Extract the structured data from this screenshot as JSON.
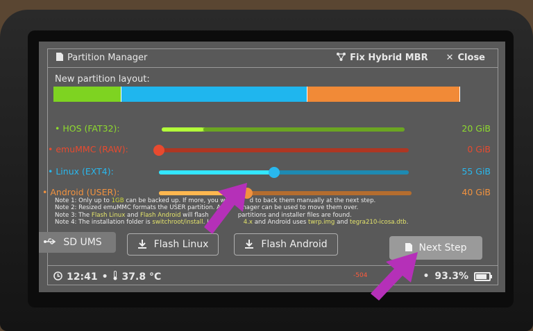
{
  "header": {
    "title": "Partition Manager",
    "title_icon": "sd-card-icon",
    "fix_hybrid_mbr": "Fix Hybrid MBR",
    "fix_icon": "network-icon",
    "close": "Close",
    "close_icon": "close-icon"
  },
  "layout": {
    "subtitle": "New partition layout:",
    "segments": [
      {
        "name": "HOS",
        "share": 0.1667,
        "color": "#7ed321"
      },
      {
        "name": "Linux",
        "share": 0.4583,
        "color": "#1fb6ee"
      },
      {
        "name": "Android",
        "share": 0.375,
        "color": "#f18a37"
      }
    ]
  },
  "partitions": [
    {
      "label": "• HOS (FAT32):",
      "size": "20 GiB",
      "color": "#8fdc2e",
      "fill_fraction": 0.17
    },
    {
      "label": "• emuMMC (RAW):",
      "size": "0 GiB",
      "color": "#e84a2f",
      "fill_fraction": 0.0
    },
    {
      "label": "• Linux (EXT4):",
      "size": "55 GiB",
      "color": "#29b8ee",
      "fill_fraction": 0.46
    },
    {
      "label": "• Android (USER):",
      "size": "40 GiB",
      "color": "#f1923f",
      "fill_fraction": 0.35
    }
  ],
  "notes": {
    "line1_a": "Note 1: Only up to ",
    "line1_hl": "1GB",
    "line1_b": " can be backed up. If more, you will",
    "line1_c": "d to back them manually at the next step.",
    "line2_a": "Note 2: Resized emuMMC formats the USER partition. A",
    "line2_b": "anager can be used to move them over.",
    "line3_a": "Note 3: The ",
    "line3_hl1": "Flash Linux",
    "line3_b": " and ",
    "line3_hl2": "Flash Android",
    "line3_c": " will flash",
    "line3_d": "partitions and installer files are found.",
    "line4_a": "Note 4: The installation folder is ",
    "line4_hl1": "switchroot/install",
    "line4_b": ". Lin",
    "line4_c": "4.x",
    "line4_d": " and Android uses ",
    "line4_hl2": "twrp.img",
    "line4_e": " and ",
    "line4_hl3": "tegra210-icosa.dtb",
    "line4_f": "."
  },
  "buttons": {
    "sd_ums": "SD UMS",
    "flash_linux": "Flash Linux",
    "flash_android": "Flash Android",
    "next_step": "Next Step"
  },
  "status": {
    "time": "12:41",
    "temp": "37.8 °C",
    "error": "-504",
    "battery": "93.3%",
    "battery_level": 0.933
  },
  "arrow_color": "#b530b8"
}
